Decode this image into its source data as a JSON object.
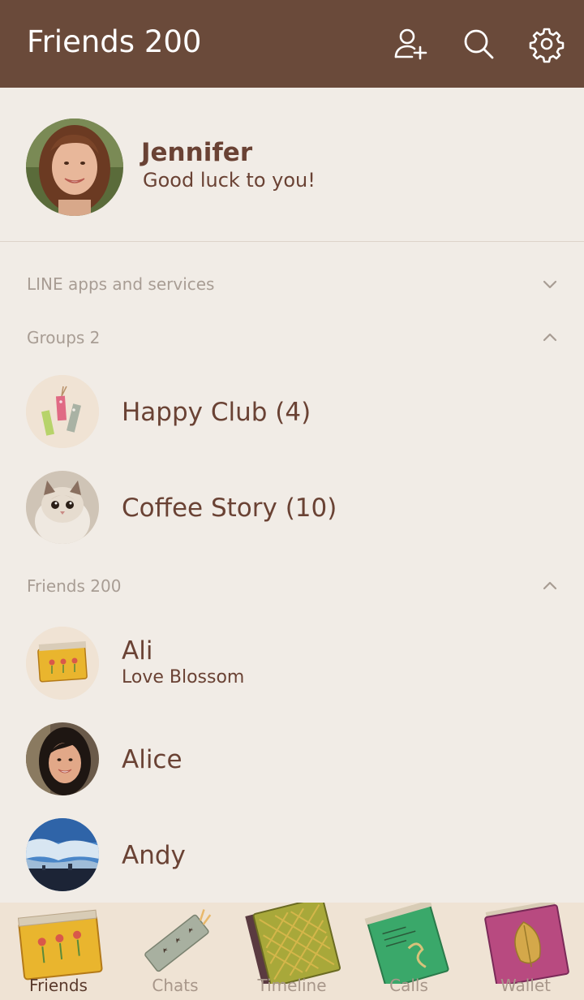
{
  "header": {
    "title": "Friends 200",
    "icons": [
      "add-friend-icon",
      "search-icon",
      "settings-gear-icon"
    ]
  },
  "profile": {
    "name": "Jennifer",
    "status": "Good luck to you!"
  },
  "sections": {
    "apps": {
      "label": "LINE apps and services",
      "state": "collapsed"
    },
    "groups": {
      "label": "Groups 2",
      "state": "expanded"
    },
    "friends": {
      "label": "Friends 200",
      "state": "expanded"
    }
  },
  "groups": [
    {
      "name": "Happy Club (4)"
    },
    {
      "name": "Coffee Story (10)"
    }
  ],
  "friends": [
    {
      "name": "Ali",
      "status": "Love Blossom"
    },
    {
      "name": "Alice",
      "status": ""
    },
    {
      "name": "Andy",
      "status": ""
    }
  ],
  "tabs": [
    {
      "label": "Friends",
      "active": true
    },
    {
      "label": "Chats",
      "active": false
    },
    {
      "label": "Timeline",
      "active": false
    },
    {
      "label": "Calls",
      "active": false
    },
    {
      "label": "Wallet",
      "active": false
    }
  ],
  "colors": {
    "header_bg": "#6a4a3a",
    "page_bg": "#f1ece6",
    "text_brown": "#6a4234",
    "section_grey": "#a89d94",
    "tabbar_bg": "#efe3d4"
  }
}
